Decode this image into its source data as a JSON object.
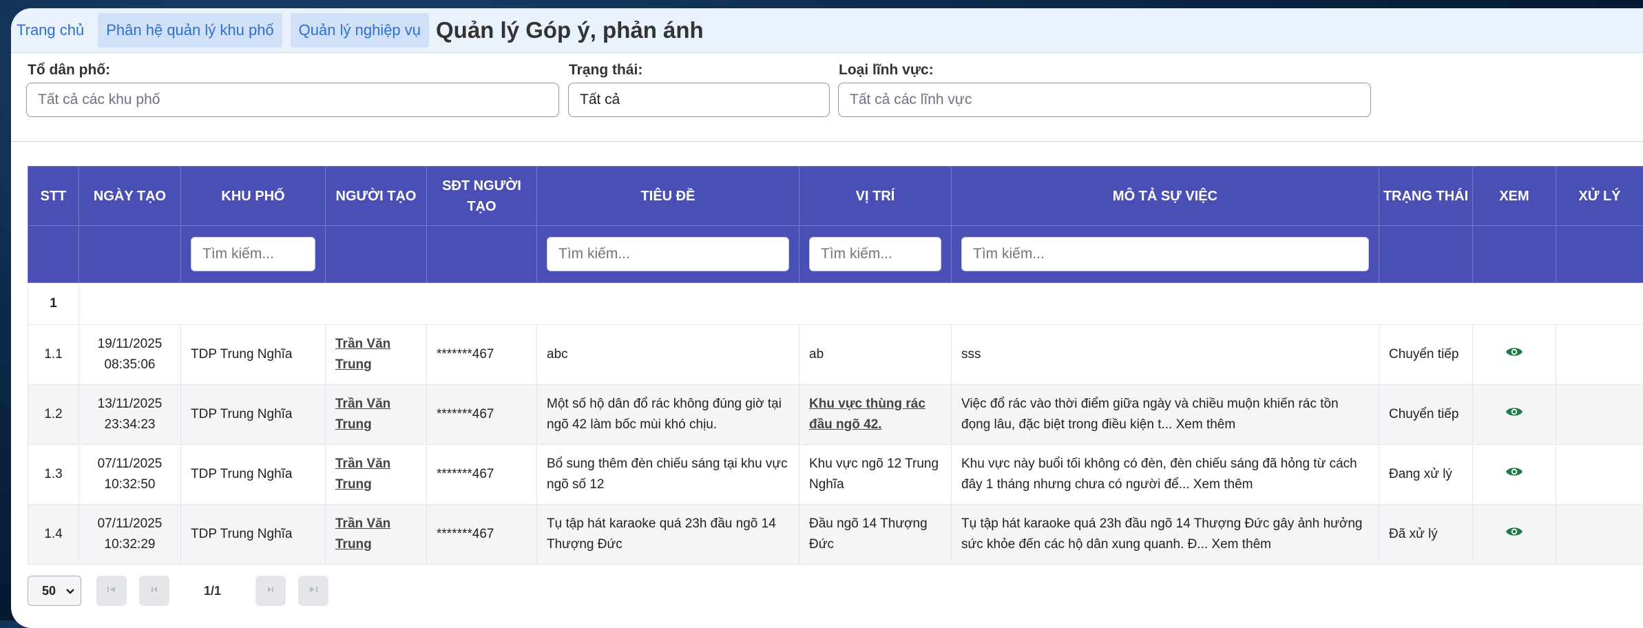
{
  "breadcrumb": [
    "Trang chủ",
    "Phân hệ quản lý khu phố",
    "Quản lý nghiệp vụ"
  ],
  "page_title": "Quản lý Góp ý, phản ánh",
  "filters": {
    "to_dan_pho": {
      "label": "Tổ dân phố:",
      "value": "Tất cả các khu phố"
    },
    "trang_thai": {
      "label": "Trạng thái:",
      "value": "Tất cả"
    },
    "loai_linh_vuc": {
      "label": "Loại lĩnh vực:",
      "value": "Tất cả các lĩnh vực"
    }
  },
  "table": {
    "headers": {
      "stt": "STT",
      "ngay_tao": "NGÀY TẠO",
      "khu_pho": "KHU PHỐ",
      "nguoi_tao": "NGƯỜI TẠO",
      "sdt": "SĐT NGƯỜI TẠO",
      "tieu_de": "TIÊU ĐỀ",
      "vi_tri": "VỊ TRÍ",
      "mo_ta": "MÔ TẢ SỰ VIỆC",
      "trang_thai": "TRẠNG THÁI",
      "xem": "XEM",
      "xu_ly": "XỬ LÝ"
    },
    "search_placeholder": "Tìm kiếm...",
    "group_label": "1",
    "rows": [
      {
        "stt": "1.1",
        "date": "19/11/2025",
        "time": "08:35:06",
        "khu_pho": "TDP Trung Nghĩa",
        "nguoi_tao": "Trần Văn Trung",
        "sdt": "*******467",
        "tieu_de": "abc",
        "vi_tri": "ab",
        "mo_ta": "sss",
        "trang_thai": "Chuyển tiếp"
      },
      {
        "stt": "1.2",
        "date": "13/11/2025",
        "time": "23:34:23",
        "khu_pho": "TDP Trung Nghĩa",
        "nguoi_tao": "Trần Văn Trung",
        "sdt": "*******467",
        "tieu_de": "Một số hộ dân đổ rác không đúng giờ tại ngõ 42 làm bốc mùi khó chịu.",
        "vi_tri": "Khu vực thùng rác đầu ngõ 42.",
        "mo_ta": "Việc đổ rác vào thời điểm giữa ngày và chiều muộn khiến rác tồn đọng lâu, đặc biệt trong điều kiện t... Xem thêm",
        "trang_thai": "Chuyển tiếp"
      },
      {
        "stt": "1.3",
        "date": "07/11/2025",
        "time": "10:32:50",
        "khu_pho": "TDP Trung Nghĩa",
        "nguoi_tao": "Trần Văn Trung",
        "sdt": "*******467",
        "tieu_de": "Bổ sung thêm đèn chiếu sáng tại khu vực ngõ số 12",
        "vi_tri": "Khu vực ngõ 12 Trung Nghĩa",
        "mo_ta": "Khu vực này buổi tối không có đèn, đèn chiếu sáng đã hỏng từ cách đây 1 tháng nhưng chưa có người để... Xem thêm",
        "trang_thai": "Đang xử lý"
      },
      {
        "stt": "1.4",
        "date": "07/11/2025",
        "time": "10:32:29",
        "khu_pho": "TDP Trung Nghĩa",
        "nguoi_tao": "Trần Văn Trung",
        "sdt": "*******467",
        "tieu_de": "Tụ tập hát karaoke quá 23h đầu ngõ 14 Thượng Đức",
        "vi_tri": "Đầu ngõ 14 Thượng Đức",
        "mo_ta": "Tụ tập hát karaoke quá 23h đầu ngõ 14 Thượng Đức gây ảnh hưởng sức khỏe đến các hộ dân xung quanh. Đ... Xem thêm",
        "trang_thai": "Đã xử lý"
      }
    ]
  },
  "status_colors": {
    "Chuyển tiếp": "#2f8ed8",
    "Đang xử lý": "#f08c2a",
    "Đã xử lý": "#2fa84f"
  },
  "eye_icon_color": "#1f7a45",
  "pagination": {
    "page_size": "50",
    "page_info": "1/1"
  }
}
